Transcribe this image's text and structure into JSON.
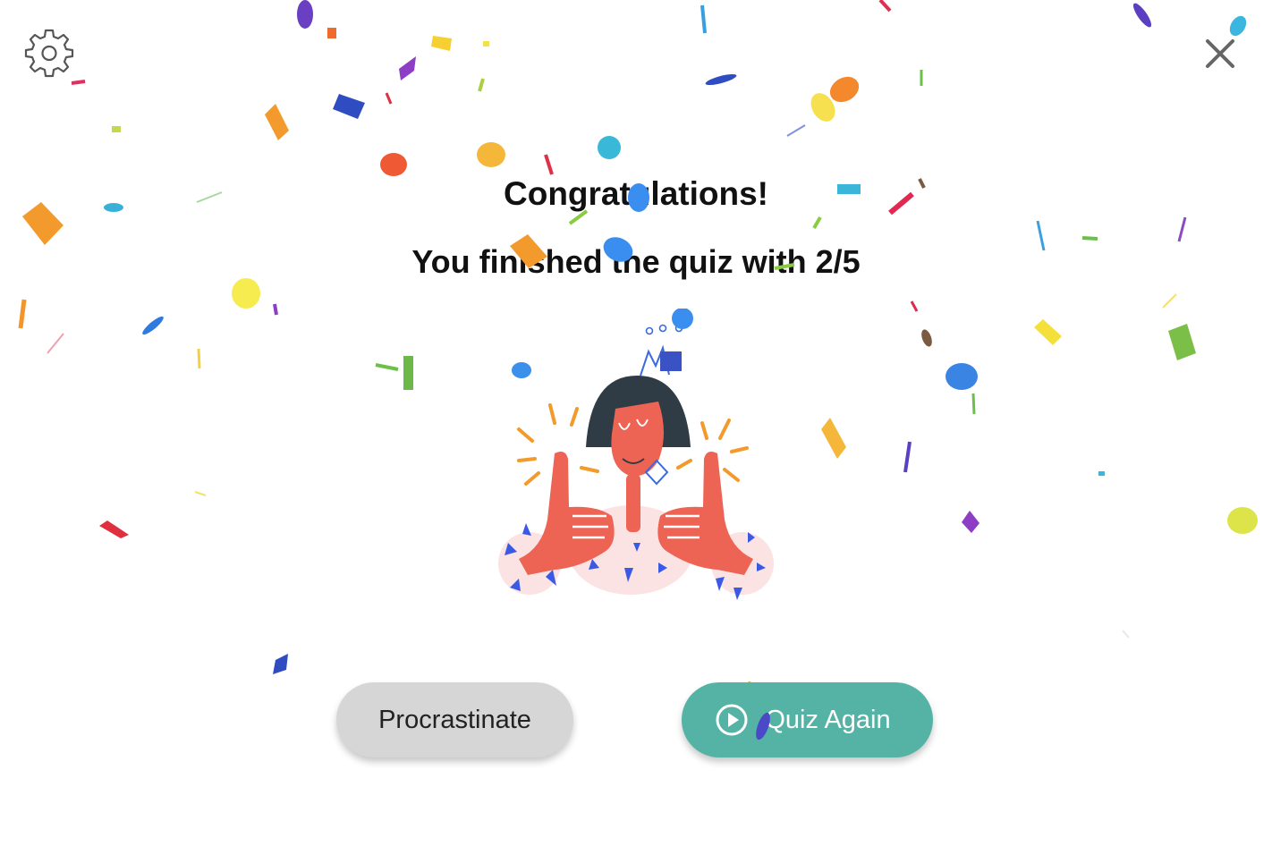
{
  "results": {
    "title": "Congratulations!",
    "summary": "You finished the quiz with 2/5"
  },
  "actions": {
    "procrastinate_label": "Procrastinate",
    "quiz_again_label": "Quiz Again"
  },
  "icons": {
    "settings": "gear-icon",
    "close": "close-icon",
    "play": "play-circle-icon"
  },
  "colors": {
    "primary_button": "#55b3a6",
    "secondary_button": "#d6d6d6",
    "illustration_skin": "#ee6454",
    "illustration_hair": "#2f3c45"
  }
}
